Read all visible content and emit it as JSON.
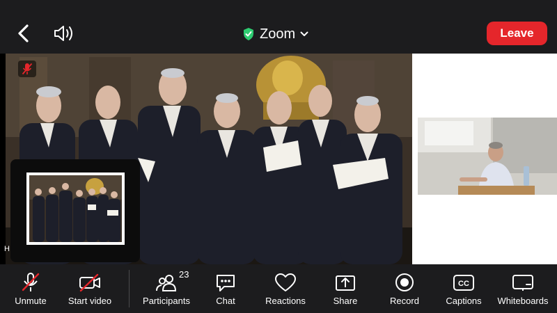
{
  "header": {
    "title": "Zoom",
    "leave_label": "Leave"
  },
  "share": {
    "speaker_name_partial": "H"
  },
  "toolbar": {
    "unmute_label": "Unmute",
    "start_video_label": "Start video",
    "participants_label": "Participants",
    "participants_count": "23",
    "chat_label": "Chat",
    "reactions_label": "Reactions",
    "share_label": "Share",
    "record_label": "Record",
    "captions_label": "Captions",
    "whiteboards_label": "Whiteboards"
  },
  "colors": {
    "accent_leave": "#e5262b",
    "secure_green": "#2ecc71",
    "muted_red": "#e5262b",
    "toolbar_bg": "#1c1c1e"
  },
  "icons": {
    "back": "chevron-left-icon",
    "speaker": "speaker-icon",
    "secure": "shield-check-icon",
    "title_dropdown": "chevron-down-icon",
    "muted": "muted-mic-icon",
    "unmute": "mic-off-icon",
    "start_video": "video-off-icon",
    "participants": "participants-icon",
    "chat": "chat-icon",
    "reactions": "heart-icon",
    "share": "share-icon",
    "record": "record-icon",
    "captions": "captions-icon",
    "whiteboards": "whiteboard-icon"
  }
}
